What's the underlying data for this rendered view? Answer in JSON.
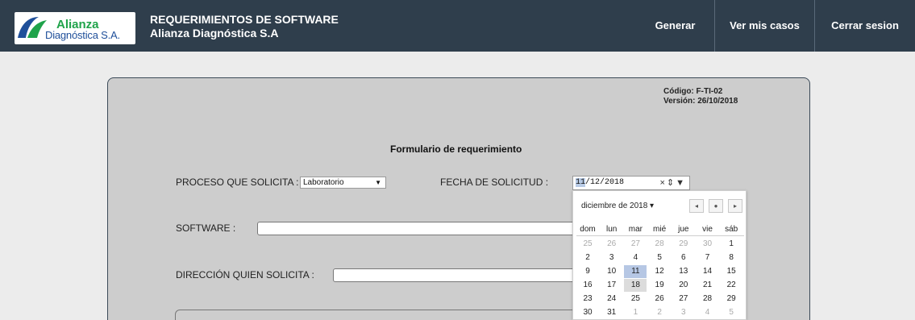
{
  "header": {
    "logo_line1": "Alianza",
    "logo_line2": "Diagnóstica S.A.",
    "title_line1": "REQUERIMIENTOS DE SOFTWARE",
    "title_line2": "Alianza Diagnóstica S.A",
    "nav": [
      "Generar",
      "Ver mis casos",
      "Cerrar sesion"
    ],
    "bg_color": "#2f3e4c"
  },
  "form": {
    "code": "Código: F-TI-02",
    "version": "Versión: 26/10/2018",
    "title": "Formulario de requerimiento",
    "proceso_label": "PROCESO QUE SOLICITA :",
    "proceso_value": "Laboratorio",
    "fecha_label": "FECHA DE SOLICITUD :",
    "fecha_day": "11",
    "fecha_rest": "/12/2018",
    "software_label": "SOFTWARE :",
    "direccion_label": "DIRECCIÓN QUIEN SOLICITA :"
  },
  "calendar": {
    "month_label": "diciembre de 2018 ▾",
    "weekdays": [
      "dom",
      "lun",
      "mar",
      "mié",
      "jue",
      "vie",
      "sáb"
    ],
    "weeks": [
      [
        "25",
        "26",
        "27",
        "28",
        "29",
        "30",
        "1"
      ],
      [
        "2",
        "3",
        "4",
        "5",
        "6",
        "7",
        "8"
      ],
      [
        "9",
        "10",
        "11",
        "12",
        "13",
        "14",
        "15"
      ],
      [
        "16",
        "17",
        "18",
        "19",
        "20",
        "21",
        "22"
      ],
      [
        "23",
        "24",
        "25",
        "26",
        "27",
        "28",
        "29"
      ],
      [
        "30",
        "31",
        "1",
        "2",
        "3",
        "4",
        "5"
      ]
    ],
    "selected_day": "11",
    "today_day": "18"
  }
}
